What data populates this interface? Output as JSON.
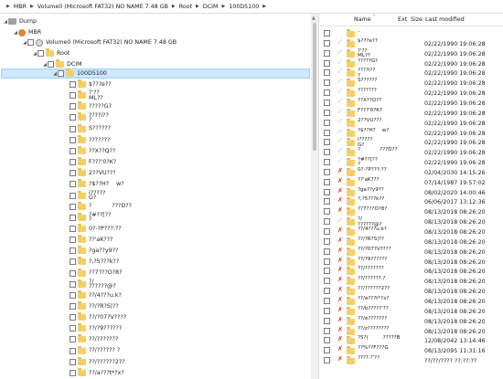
{
  "breadcrumb": [
    "MBR",
    "Volume0 (Microsoft FAT32) NO NAME  7.48 GB",
    "Root",
    "DCIM",
    "100D5100"
  ],
  "tree": {
    "root_items": [
      {
        "label": "Dump",
        "icon": "drive-icon"
      },
      {
        "label": "MBR",
        "icon": "mbr-icon"
      },
      {
        "label": "Volume0 (Microsoft FAT32) NO NAME  7.48 GB",
        "icon": "volume-icon"
      },
      {
        "label": "Root",
        "icon": "folder-icon"
      },
      {
        "label": "DCIM",
        "icon": "folder-icon"
      },
      {
        "label": "100D5100",
        "icon": "folder-icon"
      }
    ],
    "children": [
      "$???e??",
      "?'??\nML??",
      "?????G?",
      "????i??\n?",
      "S??????",
      "???????",
      "??X??Q??",
      "F???'0?K?",
      "2??VU???",
      "?$??H?    w?",
      "i?????\nG?",
      "?           ???D??",
      "?#??[??\n?",
      "0?-?P???:??",
      "??'aK???",
      "?ga??y9??",
      "?,?5???k??",
      "??7???O?8?",
      "?/\n??????@?",
      "??/4???u.k?",
      "??/?R?S|??",
      "??/?07?V????",
      "??/?9??????",
      "??/???????",
      "??/?????? ?",
      "??/??????2??",
      "??/a???t*?x?"
    ]
  },
  "list": {
    "columns": {
      "name": "Name",
      "ext": "Ext",
      "size": "Size",
      "modified": "Last modified"
    },
    "rows": [
      {
        "name": "..",
        "date": "",
        "status": "none"
      },
      {
        "name": "$???e??",
        "date": "02/22/1990 19:06:28",
        "status": "gray"
      },
      {
        "name": "?'??\nML??",
        "date": "02/22/1990 19:06:28",
        "status": "gray"
      },
      {
        "name": "?????G?",
        "date": "02/22/1990 19:06:28",
        "status": "gray"
      },
      {
        "name": "????i??\n?",
        "date": "02/22/1990 19:06:28",
        "status": "gray"
      },
      {
        "name": "S??????",
        "date": "02/22/1990 19:06:28",
        "status": "gray"
      },
      {
        "name": "???????",
        "date": "02/22/1990 19:06:28",
        "status": "gray"
      },
      {
        "name": "??X??Q??",
        "date": "02/22/1990 19:06:28",
        "status": "gray"
      },
      {
        "name": "F???'0?K?",
        "date": "02/22/1990 19:06:28",
        "status": "gray"
      },
      {
        "name": "2??VU???",
        "date": "02/22/1990 19:06:28",
        "status": "gray"
      },
      {
        "name": "?$??H?    w?",
        "date": "02/22/1990 19:06:28",
        "status": "gray"
      },
      {
        "name": "i?????\nG?",
        "date": "02/22/1990 19:06:28",
        "status": "gray"
      },
      {
        "name": "?            ???D??",
        "date": "02/22/1990 19:06:28",
        "status": "gray"
      },
      {
        "name": "?#??[??\n?",
        "date": "02/22/1990 19:06:28",
        "status": "gray"
      },
      {
        "name": "0?-?P???:??",
        "date": "02/04/2030 14:15:26",
        "status": "red"
      },
      {
        "name": "??'aK???",
        "date": "07/14/1987 19:57:02",
        "status": "red"
      },
      {
        "name": "?ga??y9??",
        "date": "08/02/2020 14:00:46",
        "status": "red"
      },
      {
        "name": "?,?5???k??",
        "date": "06/06/2017 13:12:36",
        "status": "red"
      },
      {
        "name": "??7???O?8?",
        "date": "08/13/2018 08:26:20",
        "status": "red"
      },
      {
        "name": "?/\n??????@?",
        "date": "08/13/2018 08:26:20",
        "status": "gray"
      },
      {
        "name": "??/4???u.k?",
        "date": "08/13/2018 08:26:20",
        "status": "red"
      },
      {
        "name": "??/?R?S|??",
        "date": "08/13/2018 08:26:20",
        "status": "red"
      },
      {
        "name": "??/?07?V????",
        "date": "08/13/2018 08:26:20",
        "status": "red"
      },
      {
        "name": "??/?9??????",
        "date": "08/13/2018 08:26:20",
        "status": "red"
      },
      {
        "name": "??/???????",
        "date": "08/13/2018 08:26:20",
        "status": "red"
      },
      {
        "name": "??/?????? ?",
        "date": "08/13/2018 08:26:20",
        "status": "red"
      },
      {
        "name": "??/??????2??",
        "date": "08/13/2018 08:26:20",
        "status": "red"
      },
      {
        "name": "??/a???t*?x?",
        "date": "08/13/2018 08:26:20",
        "status": "red"
      },
      {
        "name": "??/b?????'??",
        "date": "08/13/2018 08:26:20",
        "status": "red"
      },
      {
        "name": "??/e???????",
        "date": "08/13/2018 08:26:20",
        "status": "red"
      },
      {
        "name": "??/z????????",
        "date": "08/13/2018 08:26:20",
        "status": "red"
      },
      {
        "name": "?5?(         ?????B",
        "date": "12/08/2042 13:14:46",
        "status": "red"
      },
      {
        "name": "??%??F???G",
        "date": "08/13/2095 11:31:16",
        "status": "red"
      },
      {
        "name": "????.?'??",
        "date": "??/??/???? ??:??:??",
        "status": "red"
      }
    ]
  }
}
